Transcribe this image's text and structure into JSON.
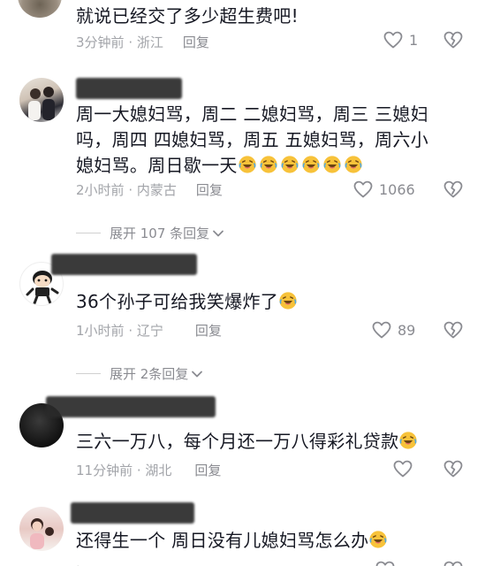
{
  "comments": [
    {
      "text": "就说已经交了多少超生费吧!",
      "time": "3分钟前",
      "location": "浙江",
      "reply_label": "回复",
      "likes": "1"
    },
    {
      "text": "周一大媳妇骂，周二 二媳妇骂，周三 三媳妇吗，周四 四媳妇骂，周五 五媳妇骂，周六小媳妇骂。周日歇一天",
      "emoji_count": 6,
      "time": "2小时前",
      "location": "内蒙古",
      "reply_label": "回复",
      "likes": "1066",
      "expand_label": "展开 107 条回复"
    },
    {
      "text": "36个孙子可给我笑爆炸了",
      "emoji_count": 1,
      "time": "1小时前",
      "location": "辽宁",
      "reply_label": "回复",
      "likes": "89",
      "expand_label": "展开 2条回复"
    },
    {
      "text": "三六一万八，每个月还一万八得彩礼贷款",
      "emoji_count": 1,
      "time": "11分钟前",
      "location": "湖北",
      "reply_label": "回复",
      "likes": ""
    },
    {
      "text": "还得生一个  周日没有儿媳妇骂怎么办",
      "emoji_count": 1,
      "time": "",
      "location": "",
      "reply_label": "",
      "likes": ""
    }
  ],
  "icons": {
    "like": "heart-outline-icon",
    "dislike": "broken-heart-icon",
    "expand": "chevron-down-icon",
    "emoji": "rofl-emoji-icon"
  },
  "colors": {
    "meta": "#a2a4a9",
    "text": "#161823",
    "emoji": "#f7c23a"
  }
}
